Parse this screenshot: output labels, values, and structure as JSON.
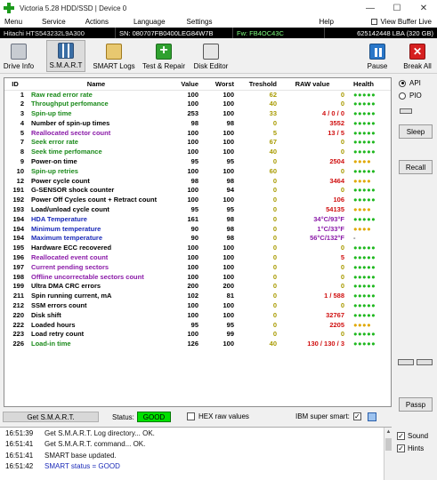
{
  "window": {
    "title": "Victoria 5.28 HDD/SSD | Device 0",
    "minimize": "—",
    "maximize": "☐",
    "close": "✕"
  },
  "menu": {
    "items": [
      "Menu",
      "Service",
      "Actions",
      "Language",
      "Settings",
      "Help"
    ],
    "view_buffer": "View Buffer Live"
  },
  "drive_info": {
    "model": "Hitachi HTS543232L9A300",
    "serial": "SN: 080707FB0400LEG84W7B",
    "firmware": "Fw: FB4OC43C",
    "lba": "625142448 LBA (320 GB)"
  },
  "toolbar": {
    "drive_info": "Drive Info",
    "smart": "S.M.A.R.T",
    "smart_logs": "SMART Logs",
    "test_repair": "Test & Repair",
    "disk_editor": "Disk Editor",
    "pause": "Pause",
    "break_all": "Break All"
  },
  "table": {
    "headers": [
      "ID",
      "Name",
      "Value",
      "Worst",
      "Treshold",
      "RAW value",
      "Health"
    ],
    "rows": [
      {
        "id": "1",
        "name": "Raw read error rate",
        "value": "100",
        "worst": "100",
        "thresh": "62",
        "raw": "0",
        "health": "●●●●●",
        "name_color": "green",
        "raw_color": "gold",
        "health_color": "green"
      },
      {
        "id": "2",
        "name": "Throughput perfomance",
        "value": "100",
        "worst": "100",
        "thresh": "40",
        "raw": "0",
        "health": "●●●●●",
        "name_color": "green",
        "raw_color": "gold",
        "health_color": "green"
      },
      {
        "id": "3",
        "name": "Spin-up time",
        "value": "253",
        "worst": "100",
        "thresh": "33",
        "raw": "4 / 0 / 0",
        "health": "●●●●●",
        "name_color": "green",
        "raw_color": "red",
        "health_color": "green"
      },
      {
        "id": "4",
        "name": "Number of spin-up times",
        "value": "98",
        "worst": "98",
        "thresh": "0",
        "raw": "3552",
        "health": "●●●●●",
        "name_color": "black",
        "raw_color": "red",
        "health_color": "green"
      },
      {
        "id": "5",
        "name": "Reallocated sector count",
        "value": "100",
        "worst": "100",
        "thresh": "5",
        "raw": "13 / 5",
        "health": "●●●●●",
        "name_color": "purple",
        "raw_color": "red",
        "health_color": "green"
      },
      {
        "id": "7",
        "name": "Seek error rate",
        "value": "100",
        "worst": "100",
        "thresh": "67",
        "raw": "0",
        "health": "●●●●●",
        "name_color": "green",
        "raw_color": "gold",
        "health_color": "green"
      },
      {
        "id": "8",
        "name": "Seek time perfomance",
        "value": "100",
        "worst": "100",
        "thresh": "40",
        "raw": "0",
        "health": "●●●●●",
        "name_color": "green",
        "raw_color": "gold",
        "health_color": "green"
      },
      {
        "id": "9",
        "name": "Power-on time",
        "value": "95",
        "worst": "95",
        "thresh": "0",
        "raw": "2504",
        "health": "●●●●",
        "name_color": "black",
        "raw_color": "red",
        "health_color": "yellow"
      },
      {
        "id": "10",
        "name": "Spin-up retries",
        "value": "100",
        "worst": "100",
        "thresh": "60",
        "raw": "0",
        "health": "●●●●●",
        "name_color": "green",
        "raw_color": "gold",
        "health_color": "green"
      },
      {
        "id": "12",
        "name": "Power cycle count",
        "value": "98",
        "worst": "98",
        "thresh": "0",
        "raw": "3464",
        "health": "●●●●",
        "name_color": "black",
        "raw_color": "red",
        "health_color": "yellow"
      },
      {
        "id": "191",
        "name": "G-SENSOR shock counter",
        "value": "100",
        "worst": "94",
        "thresh": "0",
        "raw": "0",
        "health": "●●●●●",
        "name_color": "black",
        "raw_color": "gold",
        "health_color": "green"
      },
      {
        "id": "192",
        "name": "Power Off Cycles count + Retract count",
        "value": "100",
        "worst": "100",
        "thresh": "0",
        "raw": "106",
        "health": "●●●●●",
        "name_color": "black",
        "raw_color": "red",
        "health_color": "green"
      },
      {
        "id": "193",
        "name": "Load/unload cycle count",
        "value": "95",
        "worst": "95",
        "thresh": "0",
        "raw": "54135",
        "health": "●●●●",
        "name_color": "black",
        "raw_color": "red",
        "health_color": "yellow"
      },
      {
        "id": "194",
        "name": "HDA Temperature",
        "value": "161",
        "worst": "98",
        "thresh": "0",
        "raw": "34°C/93°F",
        "health": "●●●●●",
        "name_color": "blue",
        "raw_color": "purple",
        "health_color": "green"
      },
      {
        "id": "194",
        "name": "Minimum temperature",
        "value": "90",
        "worst": "98",
        "thresh": "0",
        "raw": "1°C/33°F",
        "health": "●●●●",
        "name_color": "blue",
        "raw_color": "purple",
        "health_color": "yellow"
      },
      {
        "id": "194",
        "name": "Maximum temperature",
        "value": "90",
        "worst": "98",
        "thresh": "0",
        "raw": "56°C/132°F",
        "health": "-",
        "name_color": "blue",
        "raw_color": "purple",
        "health_color": "gray"
      },
      {
        "id": "195",
        "name": "Hardware ECC recovered",
        "value": "100",
        "worst": "100",
        "thresh": "0",
        "raw": "0",
        "health": "●●●●●",
        "name_color": "black",
        "raw_color": "gold",
        "health_color": "green"
      },
      {
        "id": "196",
        "name": "Reallocated event count",
        "value": "100",
        "worst": "100",
        "thresh": "0",
        "raw": "5",
        "health": "●●●●●",
        "name_color": "purple",
        "raw_color": "red",
        "health_color": "green"
      },
      {
        "id": "197",
        "name": "Current pending sectors",
        "value": "100",
        "worst": "100",
        "thresh": "0",
        "raw": "0",
        "health": "●●●●●",
        "name_color": "purple",
        "raw_color": "gold",
        "health_color": "green"
      },
      {
        "id": "198",
        "name": "Offline uncorrectable sectors count",
        "value": "100",
        "worst": "100",
        "thresh": "0",
        "raw": "0",
        "health": "●●●●●",
        "name_color": "purple",
        "raw_color": "gold",
        "health_color": "green"
      },
      {
        "id": "199",
        "name": "Ultra DMA CRC errors",
        "value": "200",
        "worst": "200",
        "thresh": "0",
        "raw": "0",
        "health": "●●●●●",
        "name_color": "black",
        "raw_color": "gold",
        "health_color": "green"
      },
      {
        "id": "211",
        "name": "Spin running current, mA",
        "value": "102",
        "worst": "81",
        "thresh": "0",
        "raw": "1 / 588",
        "health": "●●●●●",
        "name_color": "black",
        "raw_color": "red",
        "health_color": "green"
      },
      {
        "id": "212",
        "name": "SSM errors count",
        "value": "100",
        "worst": "100",
        "thresh": "0",
        "raw": "0",
        "health": "●●●●●",
        "name_color": "black",
        "raw_color": "gold",
        "health_color": "green"
      },
      {
        "id": "220",
        "name": "Disk shift",
        "value": "100",
        "worst": "100",
        "thresh": "0",
        "raw": "32767",
        "health": "●●●●●",
        "name_color": "black",
        "raw_color": "red",
        "health_color": "green"
      },
      {
        "id": "222",
        "name": "Loaded hours",
        "value": "95",
        "worst": "95",
        "thresh": "0",
        "raw": "2205",
        "health": "●●●●",
        "name_color": "black",
        "raw_color": "red",
        "health_color": "yellow"
      },
      {
        "id": "223",
        "name": "Load retry count",
        "value": "100",
        "worst": "99",
        "thresh": "0",
        "raw": "0",
        "health": "●●●●●",
        "name_color": "black",
        "raw_color": "gold",
        "health_color": "green"
      },
      {
        "id": "226",
        "name": "Load-in time",
        "value": "126",
        "worst": "100",
        "thresh": "40",
        "raw": "130 / 130 / 3",
        "health": "●●●●●",
        "name_color": "green",
        "raw_color": "red",
        "health_color": "green"
      }
    ]
  },
  "right_panel": {
    "api": "API",
    "pio": "PIO",
    "sleep": "Sleep",
    "recall": "Recall",
    "passp": "Passp"
  },
  "status": {
    "get_smart": "Get S.M.A.R.T.",
    "status_label": "Status:",
    "status_value": "GOOD",
    "hex_raw": "HEX raw values",
    "ibm_super": "IBM super smart:",
    "ibm_checked": "✓"
  },
  "log": [
    {
      "time": "16:51:39",
      "msg": "Get S.M.A.R.T. Log directory... OK.",
      "color": "black"
    },
    {
      "time": "16:51:41",
      "msg": "Get S.M.A.R.T. command... OK.",
      "color": "black"
    },
    {
      "time": "16:51:41",
      "msg": "SMART base updated.",
      "color": "black"
    },
    {
      "time": "16:51:42",
      "msg": "SMART status = GOOD",
      "color": "blue"
    }
  ],
  "bottom_right": {
    "sound": "Sound",
    "hints": "Hints"
  },
  "colors": {
    "status_good": "#00e000",
    "name_green": "#1a8a1a",
    "raw_red": "#d01010",
    "raw_gold": "#a89a00",
    "name_purple": "#8a1aa8",
    "name_blue": "#1a2ab8"
  }
}
